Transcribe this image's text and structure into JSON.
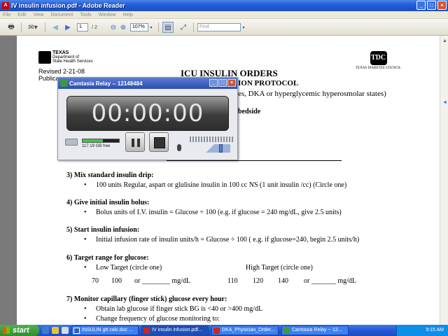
{
  "window": {
    "title": "IV insulin infusion.pdf - Adobe Reader"
  },
  "menu": [
    "File",
    "Edit",
    "View",
    "Document",
    "Tools",
    "Window",
    "Help"
  ],
  "toolbar": {
    "page_current": "1",
    "page_total": "/ 2",
    "zoom": "107%",
    "find_placeholder": "Find"
  },
  "document": {
    "texas_logo_lines": [
      "TEXAS",
      "Department of",
      "State Health Services"
    ],
    "revised": "Revised 2-21-08",
    "publication_partial": "Publica",
    "title": "ICU INSULIN ORDERS",
    "subtitle_partial": "ION PROTOCOL",
    "subtitle_line2_partial": "es, DKA or hyperglycemic hyperosmolar states)",
    "bedside_partial": "bedside",
    "tdc_logo_text": "TEXAS DIABETES COUNCIL",
    "sections": [
      {
        "title": "3)  Mix standard insulin drip:",
        "bullet": "100 units Regular, aspart or glulisine insulin in 100 cc NS  (1 unit insulin /cc)  (Circle one)"
      },
      {
        "title": "4)  Give initial insulin bolus:",
        "bullet": "Bolus units of I.V. insulin = Glucose ÷ 100 (e.g. if glucose = 240 mg/dL, give 2.5 units)"
      },
      {
        "title": "5)  Start insulin infusion:",
        "bullet": "Initial infusion rate of insulin units/h = Glucose ÷ 100 ( e.g. if glucose=240, begin 2.5 units/h)"
      }
    ],
    "target": {
      "title": "6)  Target range for glucose:",
      "low_label": "Low Target (circle one)",
      "high_label": "High Target (circle one)",
      "low_values": [
        "70",
        "100",
        "or ________  mg/dL"
      ],
      "high_values": [
        "110",
        "120",
        "140",
        "or _______  mg/dL"
      ]
    },
    "monitor": {
      "title": "7)  Monitor capillary (finger stick) glucose every hour:",
      "bullets": [
        "Obtain lab glucose if finger stick BG is <40 or >400 mg/dL",
        "Change frequency of glucose monitoring to:"
      ]
    }
  },
  "relay": {
    "title": "Camtasia Relay -- 12148484",
    "timer": "00:00:00",
    "disk_free": "117.19 GB free",
    "disk_used_fraction": 0.55,
    "volume_fraction": 0.8
  },
  "taskbar": {
    "start": "start",
    "tasks": [
      "INSULIN gtt calc.doc ...",
      "IV insulin infusion.pdf...",
      "DKA_Physician_Order...",
      "Camtasia Relay -- 12..."
    ],
    "clock": "9:15 AM"
  }
}
